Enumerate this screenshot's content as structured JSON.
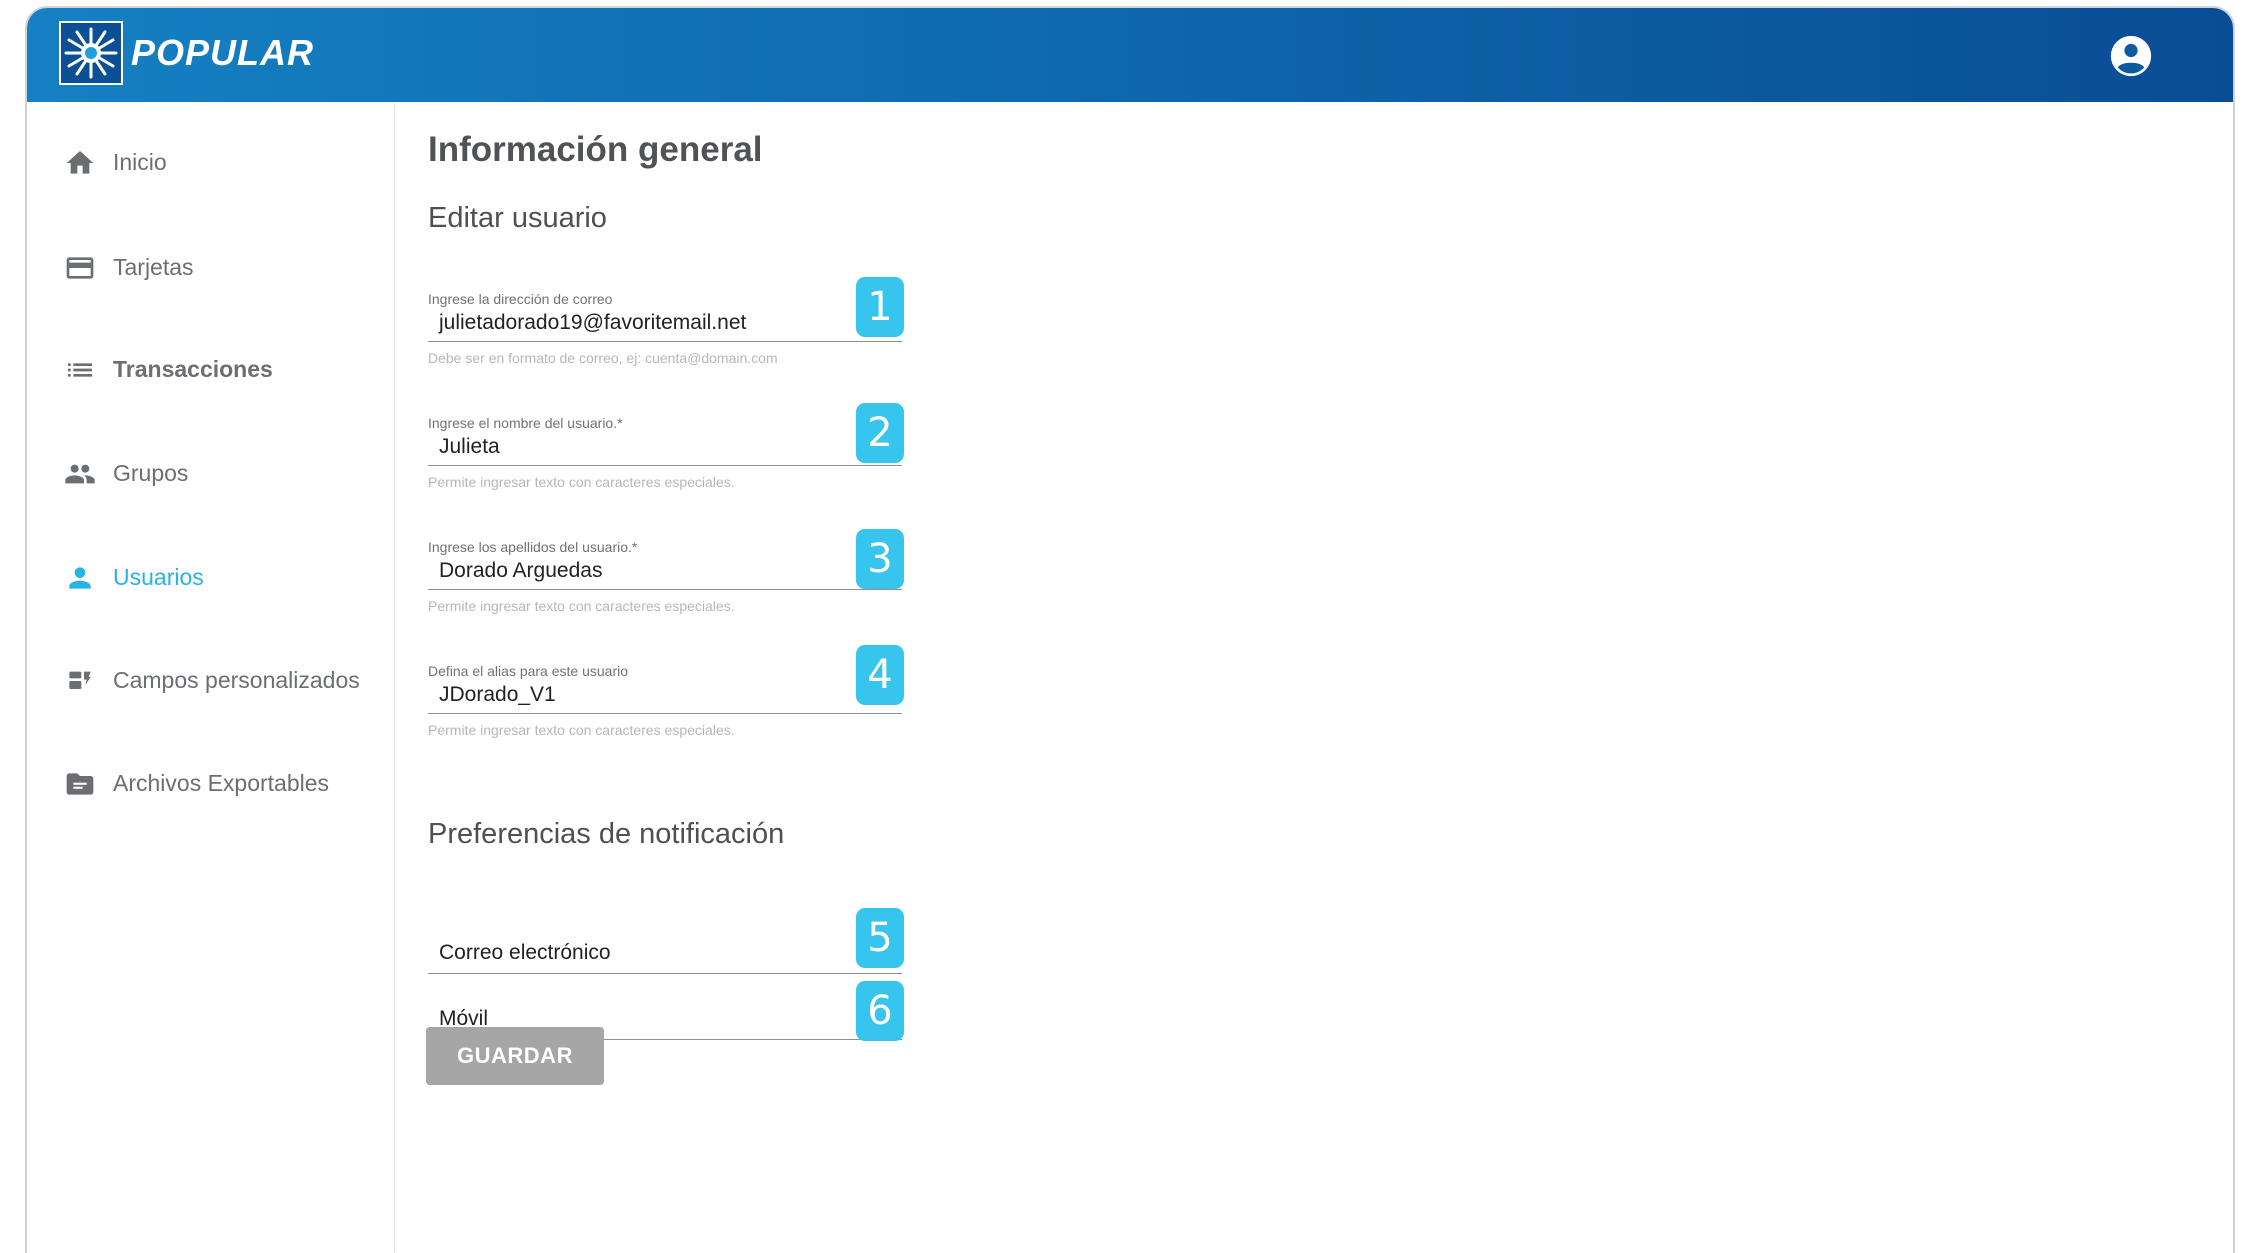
{
  "header": {
    "brand": "POPULAR",
    "colors": {
      "gradient_start": "#1580c3",
      "gradient_end": "#094d95"
    },
    "account_icon": "account-circle-icon"
  },
  "sidebar": {
    "items": [
      {
        "label": "Inicio",
        "icon": "home-icon",
        "active": false
      },
      {
        "label": "Tarjetas",
        "icon": "credit-card-icon",
        "active": false
      },
      {
        "label": "Transacciones",
        "icon": "list-icon",
        "active": false
      },
      {
        "label": "Grupos",
        "icon": "group-icon",
        "active": false
      },
      {
        "label": "Usuarios",
        "icon": "person-icon",
        "active": true
      },
      {
        "label": "Campos personalizados",
        "icon": "custom-fields-icon",
        "active": false
      },
      {
        "label": "Archivos Exportables",
        "icon": "folder-icon",
        "active": false
      }
    ],
    "active_color": "#28b3e6"
  },
  "main": {
    "page_title": "Información general",
    "section_title": "Editar usuario",
    "fields": [
      {
        "label": "Ingrese la dirección de correo",
        "value": "julietadorado19@favoritemail.net",
        "hint": "Debe ser en formato de correo, ej: cuenta@domain.com",
        "badge": "1"
      },
      {
        "label": "Ingrese el nombre del usuario.*",
        "value": "Julieta",
        "hint": "Permite ingresar texto con caracteres especiales.",
        "badge": "2"
      },
      {
        "label": "Ingrese los apellidos del usuario.*",
        "value": "Dorado Arguedas",
        "hint": "Permite ingresar texto con caracteres especiales.",
        "badge": "3"
      },
      {
        "label": "Defina el alias para este usuario",
        "value": "JDorado_V1",
        "hint": "Permite ingresar texto con caracteres especiales.",
        "badge": "4"
      }
    ],
    "notifications": {
      "title": "Preferencias de notificación",
      "options": [
        {
          "label": "Correo electrónico",
          "badge": "5"
        },
        {
          "label": "Móvil",
          "badge": "6"
        }
      ]
    },
    "save_label": "GUARDAR",
    "badge_color": "#37c4ed"
  }
}
